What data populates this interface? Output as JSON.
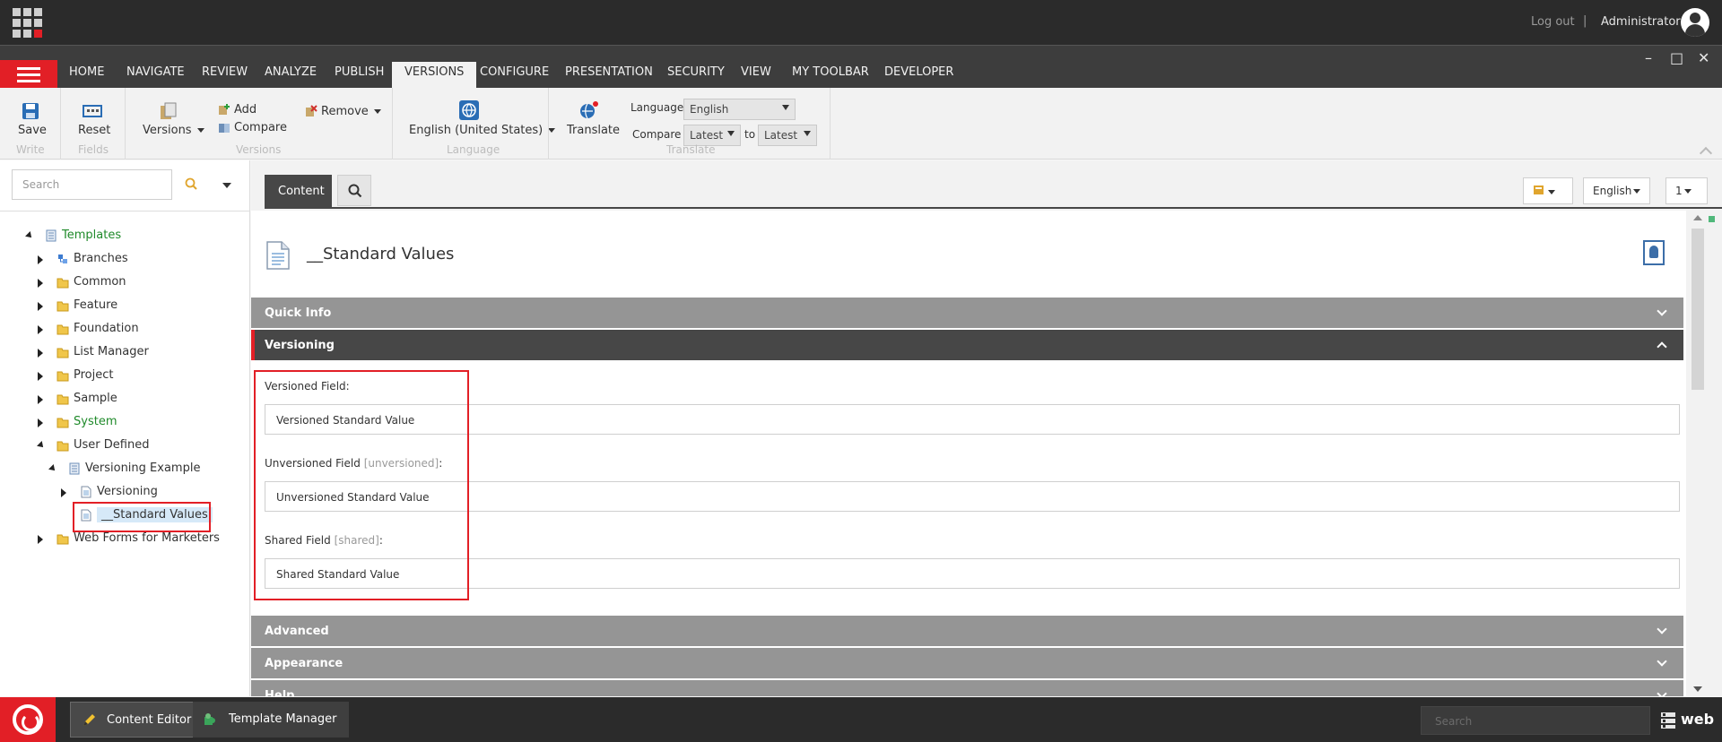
{
  "topbar": {
    "logout": "Log out",
    "separator": "|",
    "user": "Administrator"
  },
  "ribbon_tabs": [
    "HOME",
    "NAVIGATE",
    "REVIEW",
    "ANALYZE",
    "PUBLISH",
    "VERSIONS",
    "CONFIGURE",
    "PRESENTATION",
    "SECURITY",
    "VIEW",
    "MY TOOLBAR",
    "DEVELOPER"
  ],
  "active_tab": "VERSIONS",
  "window_controls": {
    "minimize": "–",
    "maximize": "□",
    "close": "✕"
  },
  "ribbon": {
    "write": {
      "save": "Save",
      "group": "Write"
    },
    "fields": {
      "reset": "Reset",
      "group": "Fields"
    },
    "versions": {
      "versions": "Versions",
      "add": "Add",
      "compare": "Compare",
      "remove": "Remove",
      "group": "Versions"
    },
    "language": {
      "current": "English (United States)",
      "group": "Language"
    },
    "translate": {
      "translate": "Translate",
      "language_label": "Language",
      "language_value": "English",
      "compare_label": "Compare",
      "compare_from": "Latest",
      "to_label": "to",
      "compare_to": "Latest",
      "group": "Translate"
    }
  },
  "left_panel": {
    "search_placeholder": "Search",
    "tree": [
      {
        "label": "Templates",
        "color": "green",
        "icon": "template-icon",
        "toggle": "open"
      },
      {
        "label": "Branches",
        "icon": "branch-icon",
        "toggle": "closed"
      },
      {
        "label": "Common",
        "icon": "folder-icon",
        "toggle": "closed"
      },
      {
        "label": "Feature",
        "icon": "folder-icon",
        "toggle": "closed"
      },
      {
        "label": "Foundation",
        "icon": "folder-icon",
        "toggle": "closed"
      },
      {
        "label": "List Manager",
        "icon": "folder-icon",
        "toggle": "closed"
      },
      {
        "label": "Project",
        "icon": "folder-icon",
        "toggle": "closed"
      },
      {
        "label": "Sample",
        "icon": "folder-icon",
        "toggle": "closed"
      },
      {
        "label": "System",
        "color": "green",
        "icon": "folder-icon",
        "toggle": "closed"
      },
      {
        "label": "User Defined",
        "icon": "folder-icon",
        "toggle": "open"
      },
      {
        "label": "Versioning Example",
        "icon": "template-icon",
        "toggle": "open"
      },
      {
        "label": "Versioning",
        "icon": "document-icon",
        "toggle": "closed"
      },
      {
        "label": "__Standard Values",
        "icon": "document-icon",
        "toggle": "none",
        "selected": true
      },
      {
        "label": "Web Forms for Marketers",
        "icon": "folder-icon",
        "toggle": "closed"
      }
    ]
  },
  "editor": {
    "content_tab": "Content",
    "toolbar": {
      "language": "English",
      "version": "1"
    },
    "item_title": "__Standard Values",
    "sections": {
      "quick_info": "Quick Info",
      "versioning": "Versioning",
      "advanced": "Advanced",
      "appearance": "Appearance",
      "help": "Help"
    },
    "fields": {
      "versioned": {
        "label": "Versioned Field:",
        "value": "Versioned Standard Value"
      },
      "unversioned": {
        "label": "Unversioned Field",
        "tag": "[unversioned]",
        "colon": ":",
        "value": "Unversioned Standard Value"
      },
      "shared": {
        "label": "Shared Field",
        "tag": "[shared]",
        "colon": ":",
        "value": "Shared Standard Value"
      }
    }
  },
  "taskbar": {
    "content_editor": "Content Editor",
    "template_manager": "Template Manager",
    "search_placeholder": "Search",
    "database": "web"
  },
  "colors": {
    "accent": "#e21f26",
    "dark": "#2b2b2b",
    "section": "#959595",
    "section_active": "#474747",
    "tree_green": "#1f8a2a"
  }
}
